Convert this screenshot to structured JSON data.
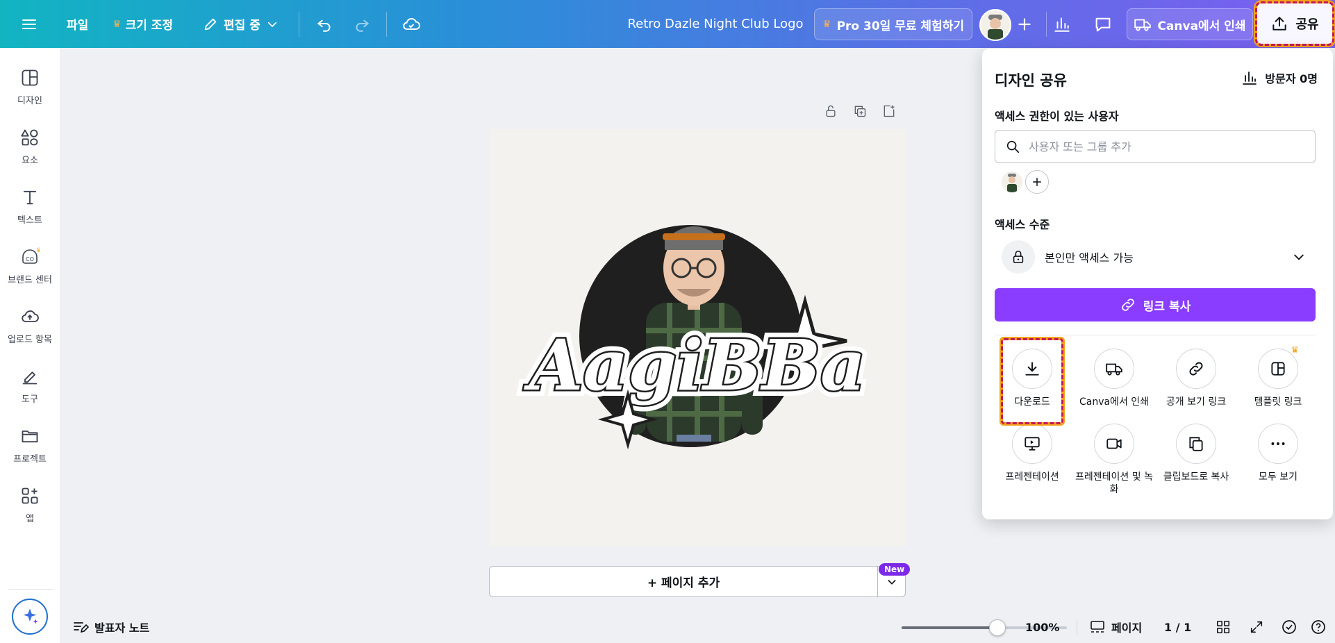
{
  "header": {
    "menu_icon": "hamburger-icon",
    "file_label": "파일",
    "resize_label": "크기 조정",
    "editing_label": "편집 중",
    "doc_title": "Retro Dazle Night Club Logo",
    "pro_trial_label": "Pro 30일 무료 체험하기",
    "print_label": "Canva에서 인쇄",
    "share_label": "공유"
  },
  "sidebar": {
    "items": [
      {
        "label": "디자인",
        "icon": "layout-icon"
      },
      {
        "label": "요소",
        "icon": "shapes-icon"
      },
      {
        "label": "텍스트",
        "icon": "text-icon"
      },
      {
        "label": "브랜드 센터",
        "icon": "brand-icon"
      },
      {
        "label": "업로드 항목",
        "icon": "upload-cloud-icon"
      },
      {
        "label": "도구",
        "icon": "draw-tool-icon"
      },
      {
        "label": "프로젝트",
        "icon": "folder-icon"
      },
      {
        "label": "앱",
        "icon": "apps-icon"
      }
    ]
  },
  "canvas": {
    "logo_text": "AagiBBa",
    "add_page_label": "+ 페이지 추가",
    "new_badge": "New"
  },
  "footer": {
    "notes_label": "발표자 노트",
    "zoom": "100%",
    "zoom_level": 0.58,
    "pages_label": "페이지",
    "page_count": "1 / 1"
  },
  "share_panel": {
    "title": "디자인 공유",
    "visitors": "방문자 0명",
    "access_users_title": "액세스 권한이 있는 사용자",
    "search_placeholder": "사용자 또는 그룹 추가",
    "access_level_title": "액세스 수준",
    "access_level_value": "본인만 액세스 가능",
    "copy_link_label": "링크 복사",
    "options": [
      {
        "label": "다운로드",
        "icon": "download-icon"
      },
      {
        "label": "Canva에서 인쇄",
        "icon": "truck-icon"
      },
      {
        "label": "공개 보기 링크",
        "icon": "link-icon"
      },
      {
        "label": "템플릿 링크",
        "icon": "template-icon"
      },
      {
        "label": "프레젠테이션",
        "icon": "presentation-icon"
      },
      {
        "label": "프레젠테이션 및 녹화",
        "icon": "video-icon"
      },
      {
        "label": "클립보드로 복사",
        "icon": "copy-icon"
      },
      {
        "label": "모두 보기",
        "icon": "more-icon"
      }
    ]
  },
  "colors": {
    "accent_purple": "#8b3dff",
    "header_gradient_start": "#12b4c2",
    "header_gradient_end": "#7d5ef0",
    "highlight_magenta": "#c2185b",
    "highlight_orange": "#f4a21a"
  }
}
